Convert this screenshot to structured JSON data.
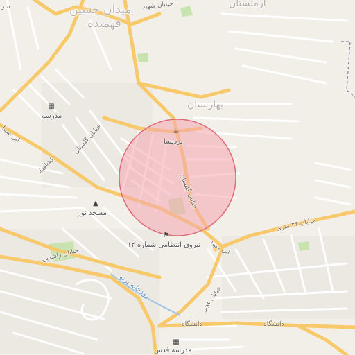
{
  "map": {
    "district_labels": {
      "bahrestan": "بهارستان",
      "fahmideh": "فهمیده",
      "meydan_hossein": "میدان حسین",
      "top_right": "ارمنستان"
    },
    "street_labels": {
      "golestan_west": "خیابان گلستان",
      "golestan_center": "خیابان گلستان",
      "keshavarz": "کشاورز",
      "ibn_sina_1": "ابن سینا",
      "ibn_sina_2": "ابن سینا",
      "twentysix_meter": "خیابان ۲۶ متری",
      "fajr": "خیابان فجر",
      "daneshgah_1": "دانشگاه",
      "daneshgah_2": "دانشگاه",
      "rashidin": "خیابان راشدین",
      "sar_fragment": "سر",
      "top_fragment": "خیابان شهید"
    },
    "river_label": "رودخانه برنو",
    "pois": [
      {
        "key": "madrese",
        "label": "مدرسه",
        "icon": "school-icon"
      },
      {
        "key": "pardis",
        "label": "پردیسا",
        "icon": "cafe-icon"
      },
      {
        "key": "masjed",
        "label": "مسجد نور",
        "icon": "mosque-icon"
      },
      {
        "key": "police",
        "label": "نیروی انتظامی شماره ۱۲",
        "icon": "police-icon"
      },
      {
        "key": "school_bottom",
        "label": "مدرسه قدس",
        "icon": "school-icon"
      }
    ],
    "highlight_circle": {
      "fill": "#f4a6ae",
      "stroke": "#e06a78"
    },
    "colors": {
      "background": "#f2efe9",
      "major_road": "#f7c96a",
      "minor_road": "#ffffff",
      "park": "#c9e3b0",
      "river": "#9cc4e8"
    }
  }
}
